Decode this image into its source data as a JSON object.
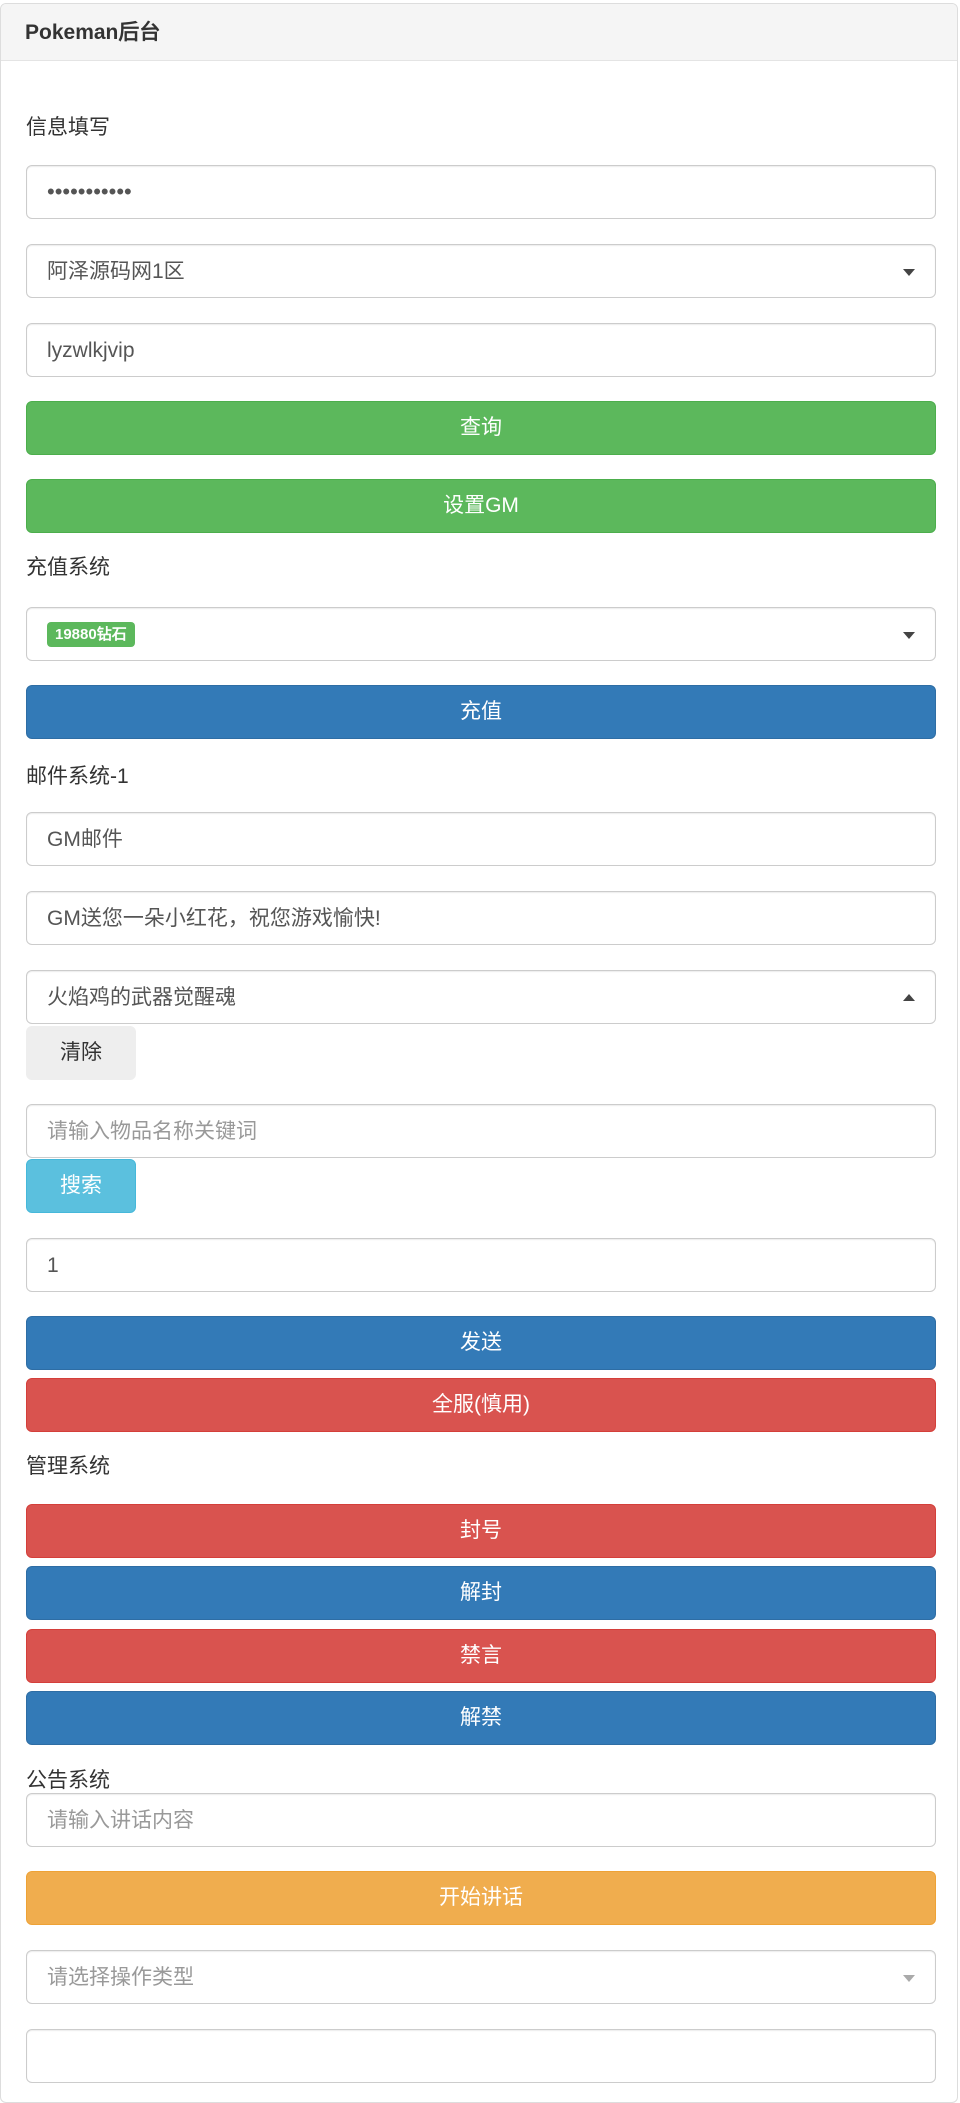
{
  "header": {
    "title": "Pokeman后台"
  },
  "info": {
    "section_label": "信息填写",
    "password_mask": "•••••••••••",
    "server_selected": "阿泽源码网1区",
    "account_value": "lyzwlkjvip",
    "query_label": "查询",
    "set_gm_label": "设置GM"
  },
  "recharge": {
    "section_label": "充值系统",
    "selected_badge": "19880钻石",
    "recharge_label": "充值"
  },
  "mail": {
    "section_label": "邮件系统-1",
    "title_value": "GM邮件",
    "content_value": "GM送您一朵小红花，祝您游戏愉快!",
    "item_selected": "火焰鸡的武器觉醒魂",
    "clear_label": "清除",
    "keyword_placeholder": "请输入物品名称关键词",
    "search_label": "搜索",
    "quantity_value": "1",
    "send_label": "发送",
    "send_all_label": "全服(慎用)"
  },
  "manage": {
    "section_label": "管理系统",
    "ban_label": "封号",
    "unban_label": "解封",
    "mute_label": "禁言",
    "unmute_label": "解禁"
  },
  "announce": {
    "section_label": "公告系统",
    "speech_placeholder": "请输入讲话内容",
    "start_label": "开始讲话",
    "op_type_placeholder": "请选择操作类型"
  },
  "colors": {
    "success": "#5cb85c",
    "primary": "#337ab7",
    "danger": "#d9534f",
    "warning": "#f0ad4e",
    "info": "#5bc0de"
  }
}
